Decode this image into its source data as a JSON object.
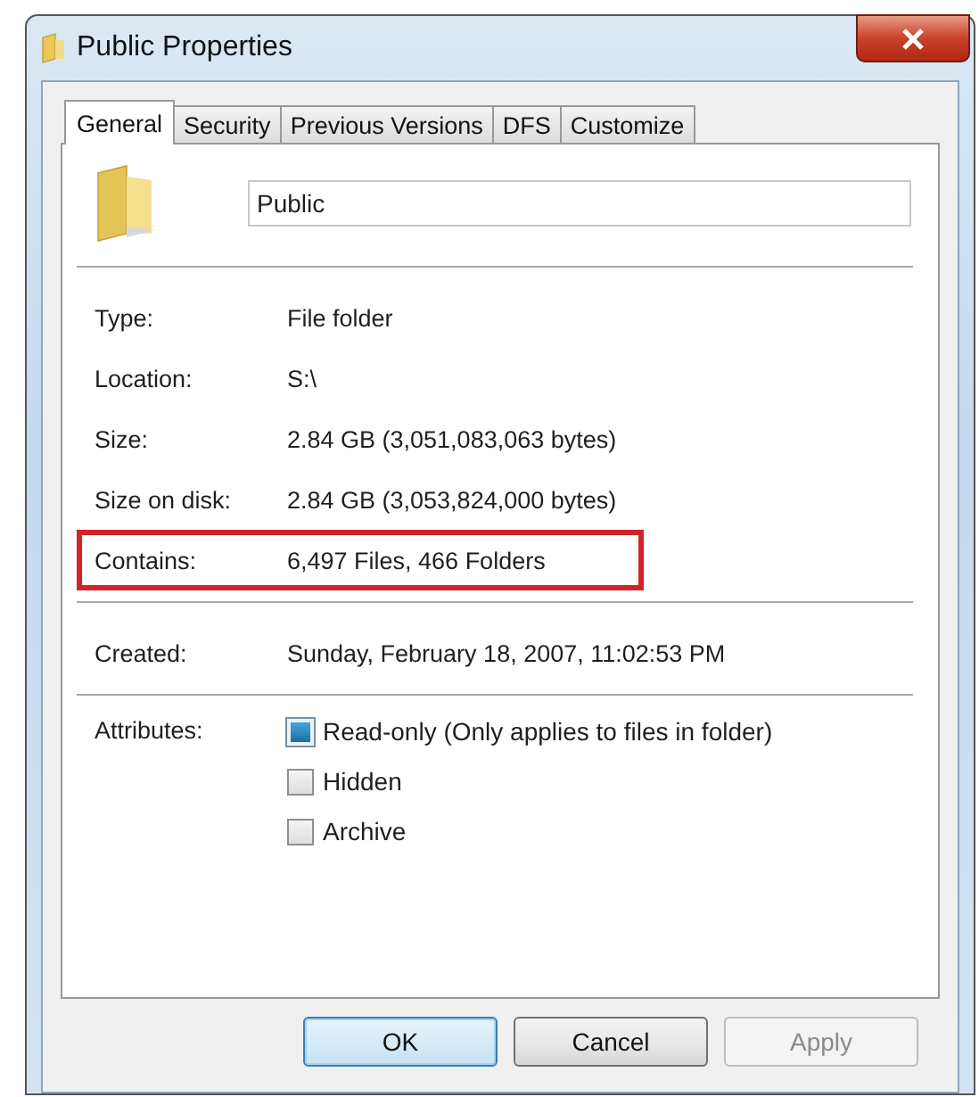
{
  "window": {
    "title": "Public Properties"
  },
  "tabs": [
    {
      "label": "General",
      "selected": true
    },
    {
      "label": "Security",
      "selected": false
    },
    {
      "label": "Previous Versions",
      "selected": false
    },
    {
      "label": "DFS",
      "selected": false
    },
    {
      "label": "Customize",
      "selected": false
    }
  ],
  "name_field": {
    "value": "Public"
  },
  "groups": [
    {
      "rows": [
        {
          "label": "Type:",
          "value": "File folder",
          "highlighted": false
        },
        {
          "label": "Location:",
          "value": "S:\\",
          "highlighted": false
        },
        {
          "label": "Size:",
          "value": "2.84 GB (3,051,083,063 bytes)",
          "highlighted": false
        },
        {
          "label": "Size on disk:",
          "value": "2.84 GB (3,053,824,000 bytes)",
          "highlighted": false
        },
        {
          "label": "Contains:",
          "value": "6,497 Files, 466 Folders",
          "highlighted": true
        }
      ]
    },
    {
      "rows": [
        {
          "label": "Created:",
          "value": "Sunday, February 18, 2007, 11:02:53 PM",
          "highlighted": false
        }
      ]
    }
  ],
  "attributes": {
    "label": "Attributes:",
    "items": [
      {
        "label": "Read-only (Only applies to files in folder)",
        "checked": false,
        "indeterminate": true
      },
      {
        "label": "Hidden",
        "checked": false,
        "indeterminate": false
      },
      {
        "label": "Archive",
        "checked": false,
        "indeterminate": false
      }
    ]
  },
  "buttons": [
    {
      "label": "OK",
      "kind": "default",
      "disabled": false
    },
    {
      "label": "Cancel",
      "kind": "normal",
      "disabled": false
    },
    {
      "label": "Apply",
      "kind": "normal",
      "disabled": true
    }
  ]
}
